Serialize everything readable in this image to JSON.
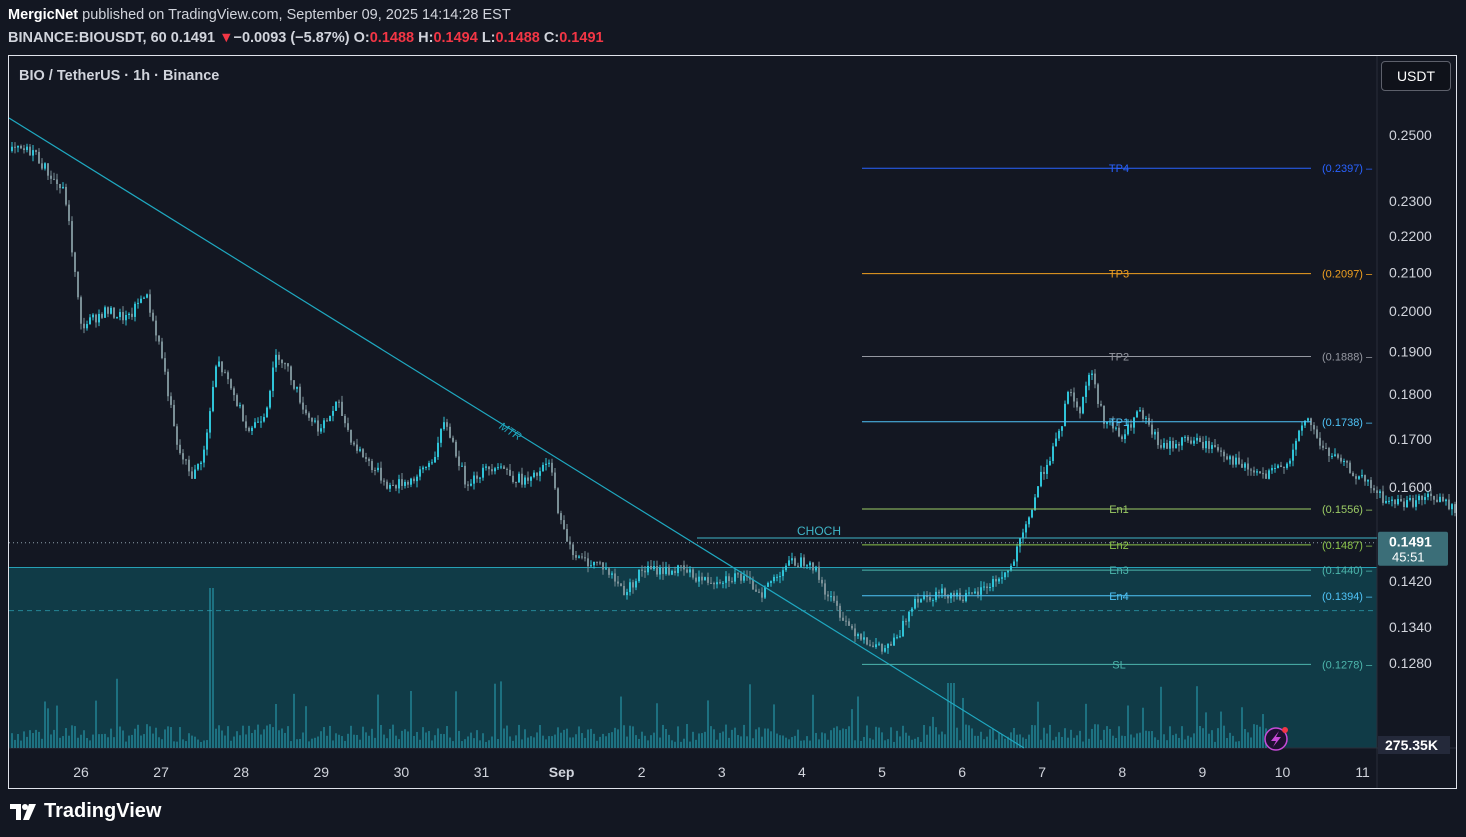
{
  "header": {
    "publisher": "MergicNet",
    "published_text": "published on TradingView.com, September 09, 2025 14:14:28 EST",
    "ticker": "BINANCE:BIOUSDT, 60",
    "price": "0.1491",
    "change_arrow": "▼",
    "change": "−0.0093 (−5.87%)",
    "o_label": "O:",
    "o_value": "0.1488",
    "h_label": "H:",
    "h_value": "0.1494",
    "l_label": "L:",
    "l_value": "0.1488",
    "c_label": "C:",
    "c_value": "0.1491"
  },
  "chart_header": {
    "symbol_title": "BIO / TetherUS · 1h · Binance",
    "currency_button": "USDT"
  },
  "footer": {
    "brand": "TradingView"
  },
  "colors": {
    "background": "#131722",
    "candle": "#2fc4d8",
    "down_red": "#f23645",
    "trendline": "#1fa8c0",
    "zone": "#0f5a66",
    "tp4": "#2962ff",
    "tp3": "#f0a020",
    "tp2": "#9598a1",
    "tp1": "#4fc3f7",
    "en1": "#9ccc65",
    "en2": "#8bc34a",
    "en3": "#4db6ac",
    "en4": "#4fc3f7",
    "sl": "#4db6ac"
  },
  "chart_data": {
    "type": "candlestick",
    "title": "BIO / TetherUS · 1h · Binance",
    "x_ticks": [
      "26",
      "27",
      "28",
      "29",
      "30",
      "31",
      "Sep",
      "2",
      "3",
      "4",
      "5",
      "6",
      "7",
      "8",
      "9",
      "10",
      "11"
    ],
    "y_ticks": [
      "0.2500",
      "0.2300",
      "0.2200",
      "0.2100",
      "0.2000",
      "0.1900",
      "0.1800",
      "0.1700",
      "0.1600",
      "0.1420",
      "0.1340",
      "0.1280"
    ],
    "y_scale": "log",
    "price_path": [
      [
        25.4,
        0.245
      ],
      [
        25.6,
        0.238
      ],
      [
        25.8,
        0.232
      ],
      [
        26.0,
        0.196
      ],
      [
        26.3,
        0.2
      ],
      [
        26.6,
        0.198
      ],
      [
        26.8,
        0.205
      ],
      [
        27.0,
        0.19
      ],
      [
        27.2,
        0.168
      ],
      [
        27.4,
        0.162
      ],
      [
        27.55,
        0.168
      ],
      [
        27.7,
        0.188
      ],
      [
        27.9,
        0.18
      ],
      [
        28.1,
        0.172
      ],
      [
        28.3,
        0.176
      ],
      [
        28.45,
        0.19
      ],
      [
        28.6,
        0.185
      ],
      [
        28.8,
        0.176
      ],
      [
        29.0,
        0.172
      ],
      [
        29.2,
        0.178
      ],
      [
        29.4,
        0.169
      ],
      [
        29.6,
        0.165
      ],
      [
        29.85,
        0.16
      ],
      [
        30.2,
        0.162
      ],
      [
        30.4,
        0.166
      ],
      [
        30.55,
        0.174
      ],
      [
        30.8,
        0.161
      ],
      [
        31.0,
        0.163
      ],
      [
        31.2,
        0.165
      ],
      [
        31.4,
        0.162
      ],
      [
        31.6,
        0.161
      ],
      [
        31.85,
        0.165
      ],
      [
        32.0,
        0.152
      ],
      [
        32.2,
        0.146
      ],
      [
        32.5,
        0.145
      ],
      [
        32.8,
        0.14
      ],
      [
        33.0,
        0.144
      ],
      [
        33.5,
        0.144
      ],
      [
        33.8,
        0.142
      ],
      [
        34.2,
        0.143
      ],
      [
        34.5,
        0.14
      ],
      [
        34.8,
        0.145
      ],
      [
        35.1,
        0.146
      ],
      [
        35.3,
        0.14
      ],
      [
        35.6,
        0.134
      ],
      [
        35.8,
        0.132
      ],
      [
        36.0,
        0.13
      ],
      [
        36.2,
        0.132
      ],
      [
        36.4,
        0.139
      ],
      [
        36.8,
        0.14
      ],
      [
        37.1,
        0.139
      ],
      [
        37.4,
        0.142
      ],
      [
        37.6,
        0.144
      ],
      [
        37.8,
        0.152
      ],
      [
        38.0,
        0.163
      ],
      [
        38.2,
        0.17
      ],
      [
        38.35,
        0.182
      ],
      [
        38.45,
        0.175
      ],
      [
        38.6,
        0.186
      ],
      [
        38.75,
        0.175
      ],
      [
        39.0,
        0.17
      ],
      [
        39.2,
        0.176
      ],
      [
        39.5,
        0.168
      ],
      [
        39.8,
        0.17
      ],
      [
        40.2,
        0.168
      ],
      [
        40.5,
        0.164
      ],
      [
        40.8,
        0.162
      ],
      [
        41.1,
        0.166
      ],
      [
        41.3,
        0.175
      ],
      [
        41.5,
        0.168
      ],
      [
        41.8,
        0.164
      ],
      [
        42.1,
        0.16
      ],
      [
        42.3,
        0.157
      ],
      [
        42.6,
        0.157
      ],
      [
        42.9,
        0.158
      ],
      [
        43.1,
        0.156
      ],
      [
        43.4,
        0.151
      ],
      [
        43.6,
        0.15
      ],
      [
        43.8,
        0.1491
      ]
    ],
    "levels": [
      {
        "label": "TP4",
        "value": "(0.2397)",
        "price": 0.2397
      },
      {
        "label": "TP3",
        "value": "(0.2097)",
        "price": 0.2097
      },
      {
        "label": "TP2",
        "value": "(0.1888)",
        "price": 0.1888
      },
      {
        "label": "TP1",
        "value": "(0.1738)",
        "price": 0.1738
      },
      {
        "label": "En1",
        "value": "(0.1556)",
        "price": 0.1556
      },
      {
        "label": "En2",
        "value": "(0.1487)",
        "price": 0.1487
      },
      {
        "label": "En3",
        "value": "(0.1440)",
        "price": 0.144
      },
      {
        "label": "En4",
        "value": "(0.1394)",
        "price": 0.1394
      },
      {
        "label": "SL",
        "value": "(0.1278)",
        "price": 0.1278
      }
    ],
    "annotations": {
      "trendline_label": "MTR",
      "choch_label": "CHOCH",
      "choch_price": 0.15,
      "zone_top_price": 0.1445,
      "last_price_label": "0.1491",
      "countdown": "45:51",
      "volume_label": "275.35K"
    }
  }
}
